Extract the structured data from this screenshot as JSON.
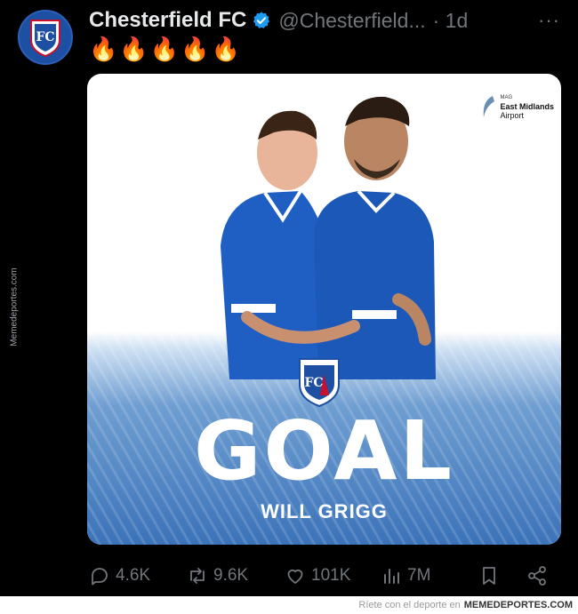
{
  "post": {
    "author_name": "Chesterfield FC",
    "handle": "@Chesterfield...",
    "time": "· 1d",
    "more": "···",
    "text": "🔥🔥🔥🔥🔥"
  },
  "media": {
    "sponsor_small": "MAG",
    "sponsor_line1": "East Midlands",
    "sponsor_line2": "Airport",
    "headline": "GOAL",
    "scorer": "WILL GRIGG"
  },
  "actions": {
    "replies": "4.6K",
    "reposts": "9.6K",
    "likes": "101K",
    "views": "7M"
  },
  "watermark": "Memedeportes.com",
  "footer": {
    "text": "Ríete con el deporte en",
    "brand": "MEMEDEPORTES.COM"
  },
  "colors": {
    "background": "#000000",
    "verified": "#1d9bf0",
    "muted": "#71767b",
    "club_blue": "#1d4fa3"
  }
}
